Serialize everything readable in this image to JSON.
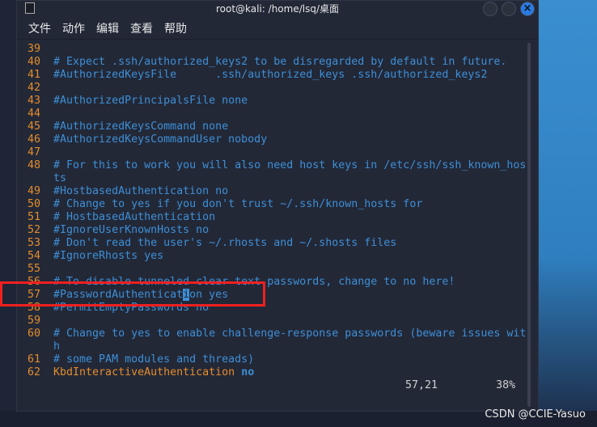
{
  "window": {
    "title": "root@kali: /home/lsq/桌面",
    "close_glyph": "×"
  },
  "menu": [
    "文件",
    "动作",
    "编辑",
    "查看",
    "帮助"
  ],
  "lines": [
    {
      "n": "39",
      "t": ""
    },
    {
      "n": "40",
      "t": "# Expect .ssh/authorized_keys2 to be disregarded by default in future."
    },
    {
      "n": "41",
      "t": "#AuthorizedKeysFile      .ssh/authorized_keys .ssh/authorized_keys2"
    },
    {
      "n": "42",
      "t": ""
    },
    {
      "n": "43",
      "t": "#AuthorizedPrincipalsFile none"
    },
    {
      "n": "44",
      "t": ""
    },
    {
      "n": "45",
      "t": "#AuthorizedKeysCommand none"
    },
    {
      "n": "46",
      "t": "#AuthorizedKeysCommandUser nobody"
    },
    {
      "n": "47",
      "t": ""
    },
    {
      "n": "48",
      "t": "# For this to work you will also need host keys in /etc/ssh/ssh_known_hos"
    },
    {
      "n": "",
      "t": "ts"
    },
    {
      "n": "49",
      "t": "#HostbasedAuthentication no"
    },
    {
      "n": "50",
      "t": "# Change to yes if you don't trust ~/.ssh/known_hosts for"
    },
    {
      "n": "51",
      "t": "# HostbasedAuthentication"
    },
    {
      "n": "52",
      "t": "#IgnoreUserKnownHosts no"
    },
    {
      "n": "53",
      "t": "# Don't read the user's ~/.rhosts and ~/.shosts files"
    },
    {
      "n": "54",
      "t": "#IgnoreRhosts yes"
    },
    {
      "n": "55",
      "t": ""
    },
    {
      "n": "56",
      "t": "# To disable tunneled clear text passwords, change to no here!"
    },
    {
      "n": "57",
      "t": "#PasswordAuthenticat",
      "cur": "i",
      "rest": "on yes"
    },
    {
      "n": "58",
      "t": "#PermitEmptyPasswords no"
    },
    {
      "n": "59",
      "t": ""
    },
    {
      "n": "60",
      "t": "# Change to yes to enable challenge-response passwords (beware issues wit"
    },
    {
      "n": "",
      "t": "h"
    },
    {
      "n": "61",
      "t": "# some PAM modules and threads)"
    },
    {
      "n": "62",
      "kw": "KbdInteractiveAuthentication",
      "val": "no"
    }
  ],
  "status": {
    "position": "57,21",
    "percent": "38%"
  },
  "watermark": "CSDN @CCIE-Yasuo",
  "colors": {
    "comment": "#3d8fd6",
    "line_number": "#e38d2c",
    "background": "#232837",
    "highlight_box": "#f02020"
  }
}
